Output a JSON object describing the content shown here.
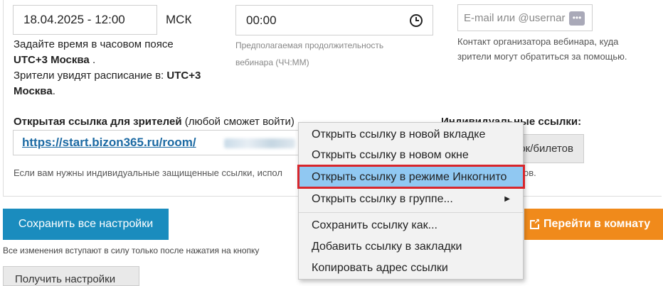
{
  "schedule": {
    "datetime_value": "18.04.2025 - 12:00",
    "timezone_label": "МСК",
    "help_line1": "Задайте время в часовом поясе",
    "help_tz_bold": "UTC+3 Москва",
    "help_line1_end": " .",
    "help_line2": "Зрители увидят расписание в:",
    "help_line2_bold": "UTC+3",
    "help_line3_bold": "Москва",
    "help_line3_end": "."
  },
  "duration": {
    "value": "00:00",
    "hint_line1": "Предполагаемая продолжительность",
    "hint_line2": "вебинара (ЧЧ:ММ)"
  },
  "contact": {
    "placeholder": "E-mail или @usernar",
    "hint_line1": "Контакт организатора вебинара, куда",
    "hint_line2": "зрители могут обратиться за помощью."
  },
  "link": {
    "label_bold": "Открытая ссылка для зрителей",
    "label_rest": " (любой сможет войти) ",
    "url": "https://start.bizon365.ru/room/",
    "individual_label": "Индивидуальные ссылки:",
    "individual_button": "ок/билетов",
    "note": "Если вам нужны индивидуальные защищенные ссылки, испол",
    "note_end": "ов."
  },
  "actions": {
    "save_all": "Сохранить все настройки",
    "go_to_room": "Перейти в комнату",
    "save_note": "Все изменения вступают в силу только после нажатия на кнопку",
    "get_settings": "Получить настройки"
  },
  "context_menu": {
    "items": [
      "Открыть ссылку в новой вкладке",
      "Открыть ссылку в новом окне",
      "Открыть ссылку в режиме Инкогнито",
      "Открыть ссылку в группе...",
      "Сохранить ссылку как...",
      "Добавить ссылку в закладки",
      "Копировать адрес ссылки"
    ],
    "highlighted_index": 2
  },
  "colors": {
    "primary": "#1a8cbe",
    "orange": "#f08a1b",
    "highlight": "#90c8f2",
    "annotation": "#d8262c"
  }
}
